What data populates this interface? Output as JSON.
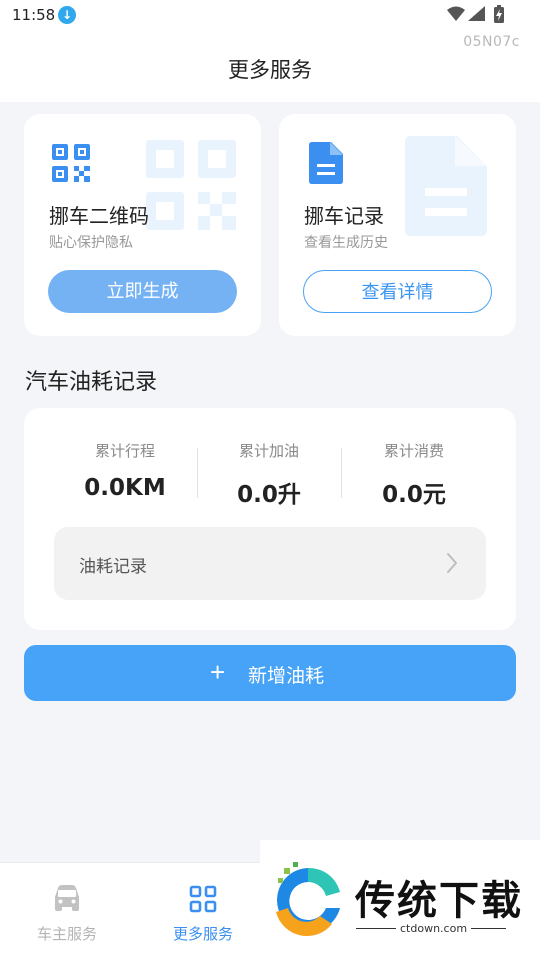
{
  "status_bar": {
    "time": "11:58",
    "download_icon": "download-icon",
    "wifi_icon": "wifi-icon",
    "signal_icon": "signal-icon",
    "battery_icon": "battery-charging-icon"
  },
  "device_id": "05N07c",
  "header": {
    "title": "更多服务"
  },
  "cards": {
    "qr": {
      "title": "挪车二维码",
      "subtitle": "贴心保护隐私",
      "button": "立即生成",
      "icon": "qr-code-icon"
    },
    "records": {
      "title": "挪车记录",
      "subtitle": "查看生成历史",
      "button": "查看详情",
      "icon": "document-icon"
    }
  },
  "fuel": {
    "section_title": "汽车油耗记录",
    "stats": [
      {
        "label": "累计行程",
        "value": "0.0KM"
      },
      {
        "label": "累计加油",
        "value": "0.0升"
      },
      {
        "label": "累计消费",
        "value": "0.0元"
      }
    ],
    "record_row": "油耗记录",
    "add_button": "新增油耗",
    "add_icon": "plus-icon"
  },
  "bottom_nav": {
    "items": [
      {
        "label": "车主服务",
        "icon": "car-icon",
        "active": false
      },
      {
        "label": "更多服务",
        "icon": "grid-icon",
        "active": true
      }
    ]
  },
  "watermark": {
    "text": "传统下载",
    "url": "ctdown.com"
  },
  "colors": {
    "accent": "#46a3f7",
    "accent_light": "#74b2f4",
    "background": "#f4f5f8"
  }
}
